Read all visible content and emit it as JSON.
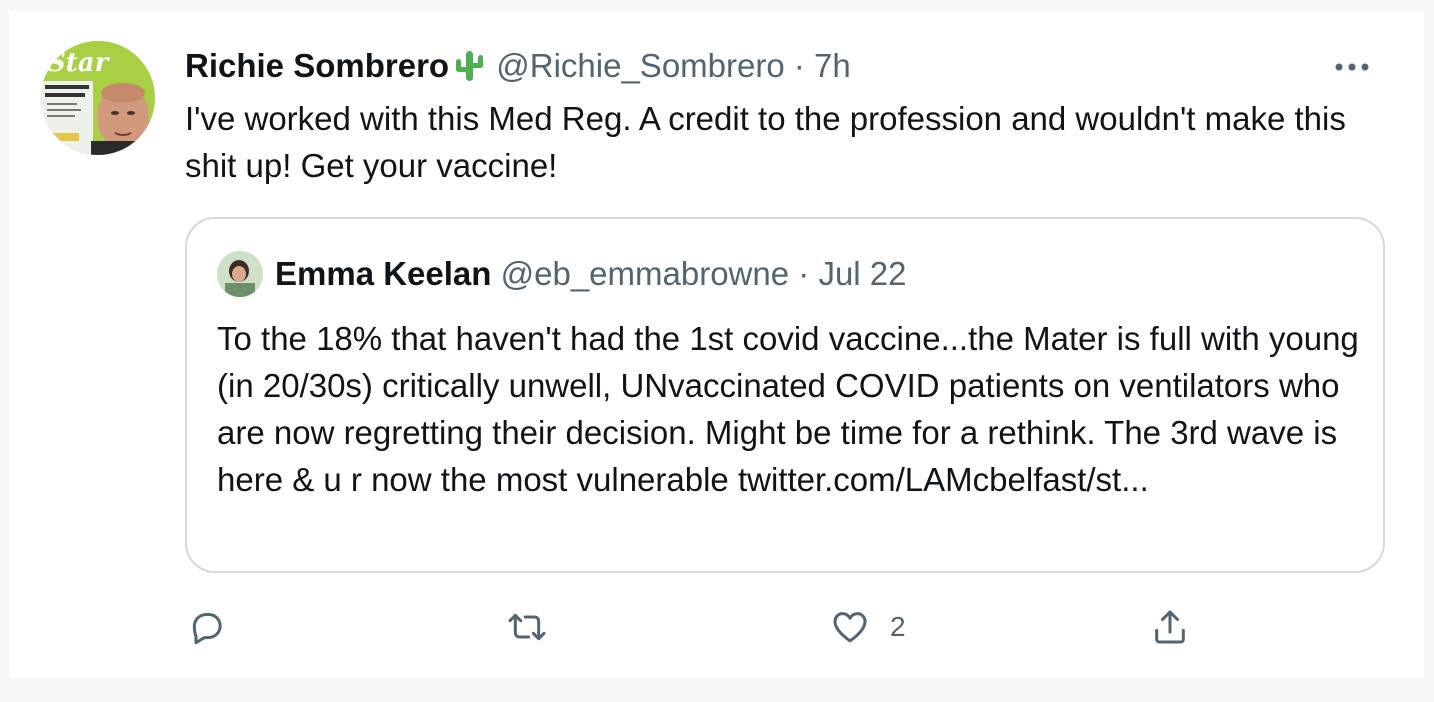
{
  "tweet": {
    "author": {
      "display_name": "Richie Sombrero",
      "emoji_icon": "cactus-emoji",
      "handle": "@Richie_Sombrero",
      "separator": "·",
      "time": "7h"
    },
    "text": "I've worked with this Med Reg. A credit to the profession and wouldn't make this shit up! Get your vaccine!",
    "more_icon": "more-horizontal-icon",
    "avatar_overlay_text": "Star"
  },
  "quoted_tweet": {
    "author": {
      "display_name": "Emma Keelan",
      "handle": "@eb_emmabrowne",
      "separator": "·",
      "date": "Jul 22"
    },
    "text": "To the 18% that haven't had the 1st covid vaccine...the Mater is full with young (in 20/30s) critically unwell, UNvaccinated COVID patients on ventilators who are now regretting their decision. Might be time for a rethink. The 3rd wave is here & u r now the most vulnerable twitter.com/LAMcbelfast/st..."
  },
  "actions": {
    "reply": {
      "icon": "reply-icon",
      "count": ""
    },
    "retweet": {
      "icon": "retweet-icon",
      "count": ""
    },
    "like": {
      "icon": "heart-icon",
      "count": "2"
    },
    "share": {
      "icon": "share-icon"
    }
  },
  "colors": {
    "text_primary": "#0f1419",
    "text_secondary": "#536471",
    "border": "#cfd9de",
    "cactus": "#4caf50"
  }
}
